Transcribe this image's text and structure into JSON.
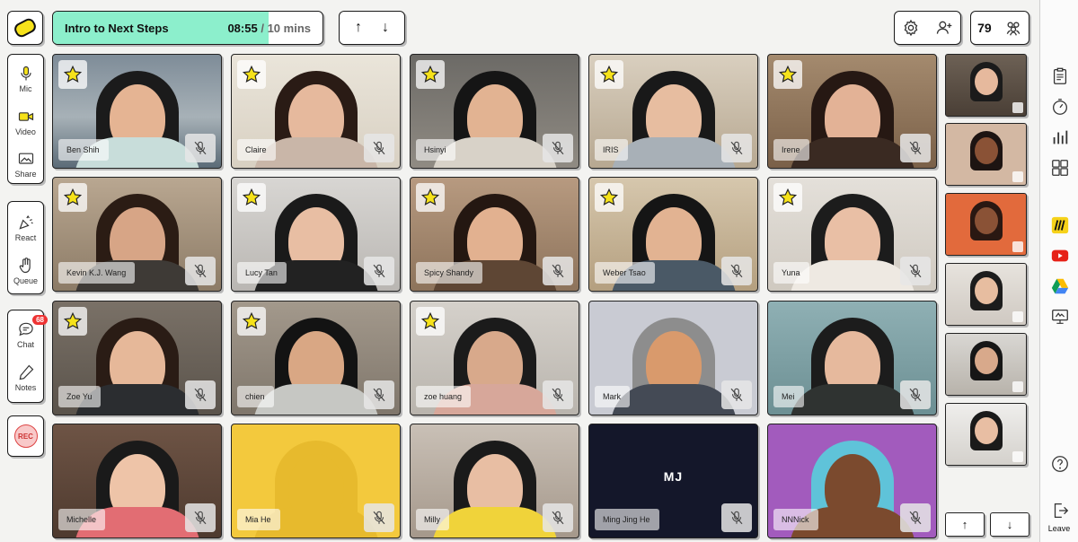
{
  "header": {
    "agenda_title": "Intro to Next Steps",
    "timer_elapsed": "08:55",
    "timer_separator": "/",
    "timer_total": "10 mins",
    "progress": 0.89,
    "participant_count": "79"
  },
  "sidebar_left": {
    "mic_label": "Mic",
    "video_label": "Video",
    "share_label": "Share",
    "react_label": "React",
    "queue_label": "Queue",
    "chat_label": "Chat",
    "chat_badge": "68",
    "notes_label": "Notes",
    "rec_label": "REC"
  },
  "participants": [
    {
      "name": "Ben Shih",
      "starred": true
    },
    {
      "name": "Claire",
      "starred": true
    },
    {
      "name": "Hsinyi",
      "starred": true
    },
    {
      "name": "IRIS",
      "starred": true
    },
    {
      "name": "Irene",
      "starred": true
    },
    {
      "name": "Kevin K.J. Wang",
      "starred": true
    },
    {
      "name": "Lucy Tan",
      "starred": true
    },
    {
      "name": "Spicy Shandy",
      "starred": true
    },
    {
      "name": "Weber Tsao",
      "starred": true
    },
    {
      "name": "Yuna",
      "starred": true
    },
    {
      "name": "Zoe Yu",
      "starred": true
    },
    {
      "name": "chien",
      "starred": true
    },
    {
      "name": "zoe huang",
      "starred": true
    },
    {
      "name": "Mark",
      "starred": false
    },
    {
      "name": "Mei",
      "starred": false
    },
    {
      "name": "Michelle",
      "starred": false
    },
    {
      "name": "Mia He",
      "starred": false
    },
    {
      "name": "Milly",
      "starred": false
    },
    {
      "name": "Ming Jing He",
      "starred": false,
      "initials": "MJ"
    },
    {
      "name": "NNNick",
      "starred": false
    }
  ],
  "sidebar_right": {
    "leave_label": "Leave"
  },
  "colors": {
    "progress": "#8cefcc",
    "logo": "#f6e21a",
    "star": "#f6e21a",
    "rec": "#f8c9c9"
  }
}
